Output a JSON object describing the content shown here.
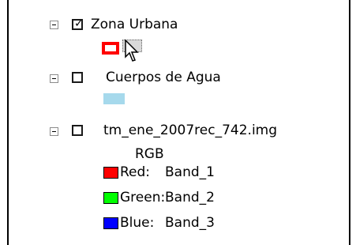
{
  "toc": {
    "layers": [
      {
        "name": "Zona Urbana",
        "checked": true,
        "expanded": true,
        "symbol": {
          "type": "outline",
          "outline_color": "#ff0000",
          "fill": "#ffffff"
        }
      },
      {
        "name": "Cuerpos de Agua",
        "checked": false,
        "expanded": true,
        "symbol": {
          "type": "fill",
          "fill": "#a6d9ec"
        }
      },
      {
        "name": "tm_ene_2007rec_742.img",
        "checked": false,
        "expanded": true,
        "renderer": "RGB",
        "bands": [
          {
            "channel": "Red:",
            "band": "Band_1",
            "color": "#ff0000"
          },
          {
            "channel": "Green:",
            "band": "Band_2",
            "color": "#00ff00"
          },
          {
            "channel": "Blue:",
            "band": "Band_3",
            "color": "#0000ff"
          }
        ]
      }
    ],
    "checkmark_glyph": "✓"
  }
}
